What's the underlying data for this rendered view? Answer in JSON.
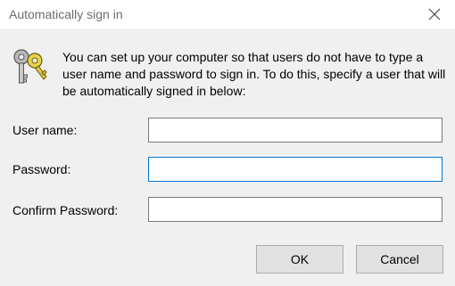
{
  "window": {
    "title": "Automatically sign in",
    "close_icon": "close-icon"
  },
  "dialog": {
    "icon": "keys-icon",
    "description": "You can set up your computer so that users do not have to type a user name and password to sign in. To do this, specify a user that will be automatically signed in below:"
  },
  "fields": {
    "username": {
      "label": "User name:",
      "value": ""
    },
    "password": {
      "label": "Password:",
      "value": ""
    },
    "confirm_password": {
      "label": "Confirm Password:",
      "value": ""
    }
  },
  "buttons": {
    "ok": "OK",
    "cancel": "Cancel"
  },
  "colors": {
    "titlebar_bg": "#ffffff",
    "dialog_bg": "#f0f0f0",
    "focus_border": "#0078d7",
    "button_bg": "#e1e1e1"
  }
}
